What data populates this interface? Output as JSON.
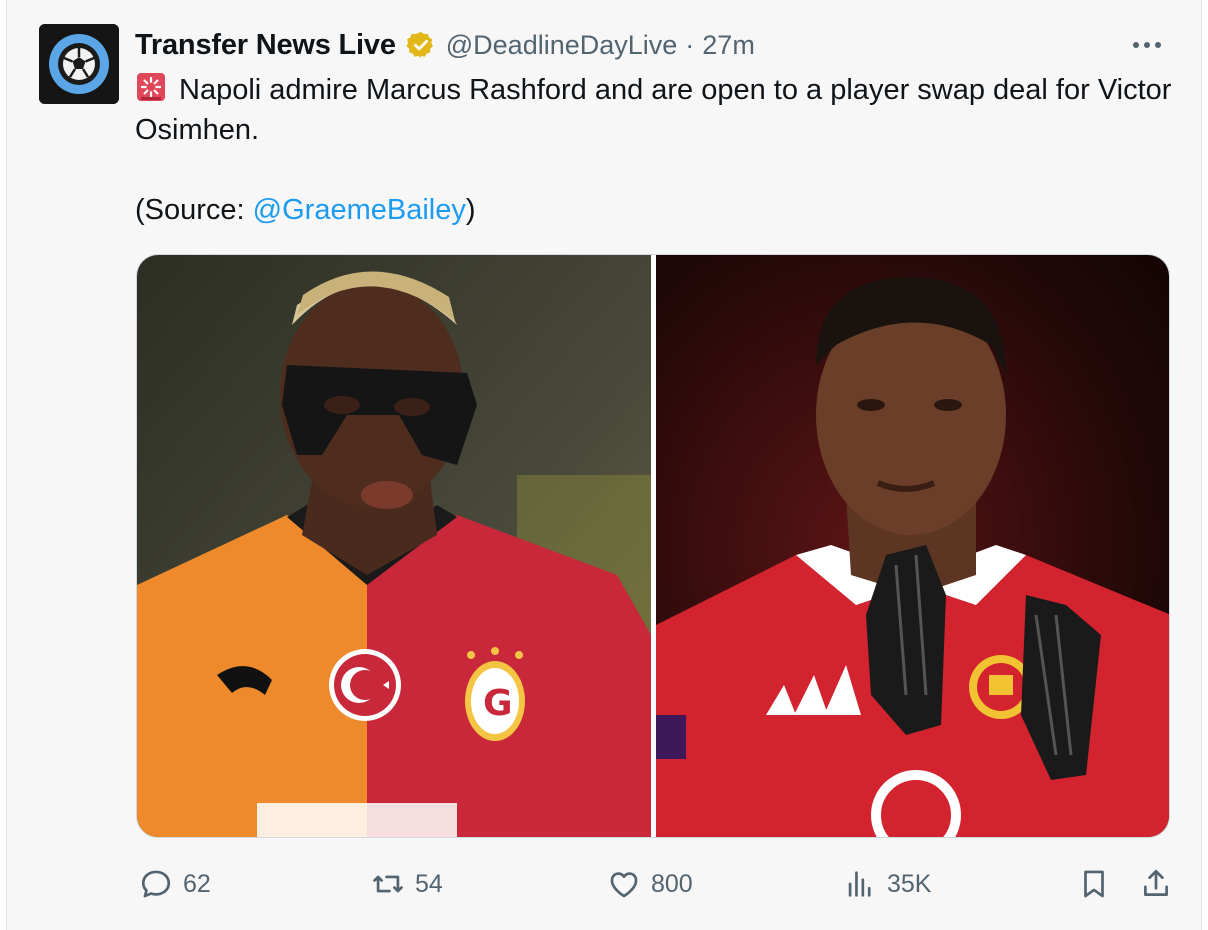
{
  "tweet": {
    "author_name": "Transfer News Live",
    "handle": "@DeadlineDayLive",
    "separator": "·",
    "time": "27m",
    "text_line": "Napoli admire Marcus Rashford and are open to a player swap deal for Victor Osimhen.",
    "source_prefix": "(Source: ",
    "source_mention": "@GraemeBailey",
    "source_suffix": ")",
    "emoji": "siren-emoji"
  },
  "media": {
    "left_image": "Victor Osimhen in Galatasaray shirt wearing face mask",
    "right_image": "Marcus Rashford in Manchester United shirt clapping"
  },
  "actions": {
    "reply_count": "62",
    "retweet_count": "54",
    "like_count": "800",
    "views_count": "35K"
  },
  "colors": {
    "accent": "#1d9bf0",
    "muted": "#536471",
    "verified_gold": "#e2b719",
    "background": "#f7f7f7"
  },
  "icons": [
    "soccer-ball-avatar-icon",
    "verified-badge-icon",
    "more-icon",
    "reply-icon",
    "retweet-icon",
    "like-icon",
    "views-icon",
    "bookmark-icon",
    "share-icon"
  ]
}
